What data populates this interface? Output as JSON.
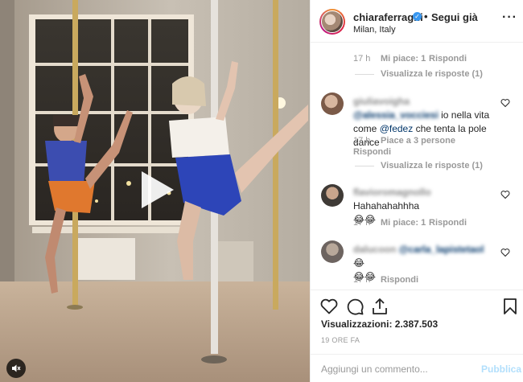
{
  "post": {
    "username": "chiaraferragni",
    "separator": "•",
    "follow_label": "Segui già",
    "location": "Milan, Italy",
    "more_label": "···"
  },
  "comments": [
    {
      "time": "17 h",
      "likes": "Mi piace: 1",
      "reply": "Rispondi",
      "view_replies": "Visualizza le risposte (1)"
    },
    {
      "author": "giuliavoigha",
      "text_parts": [
        "@alessia_vocciesi",
        " io nella vita come ",
        "@fedez",
        " che tenta la pole dance"
      ],
      "time": "17 h",
      "likes": "Piace a 3 persone",
      "reply": "Rispondi",
      "view_replies": "Visualizza le risposte (1)"
    },
    {
      "author": "flavioromagnollo",
      "text": "Hahahahahhha",
      "emojis": [
        "😂",
        "😂"
      ],
      "time": "17 h",
      "likes": "Mi piace: 1",
      "reply": "Rispondi"
    },
    {
      "author": "dalucoon",
      "mention": "@carla_lapistetaol",
      "emojis": [
        "😂",
        "😂",
        "😂"
      ],
      "time": "17 h",
      "reply": "Rispondi"
    }
  ],
  "stats": {
    "views": "Visualizzazioni: 2.387.503",
    "time_ago": "19 ORE FA"
  },
  "comment_box": {
    "placeholder": "Aggiungi un commento...",
    "publish_label": "Pubblica"
  },
  "icons": {
    "verified": "verified-badge-icon",
    "like": "heart-icon",
    "comment": "comment-icon",
    "share": "share-icon",
    "save": "bookmark-icon",
    "play": "play-icon",
    "mute": "speaker-muted-icon"
  },
  "colors": {
    "verified_blue": "#3897f0",
    "publish_disabled": "#b2dffc",
    "meta_grey": "#999999",
    "mention_blue": "#003569"
  }
}
